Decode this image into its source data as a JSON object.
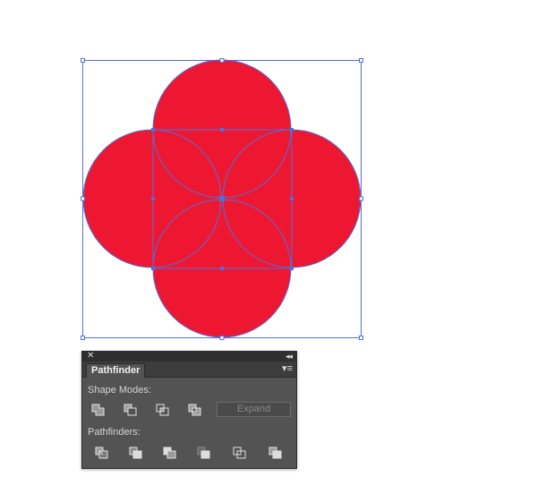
{
  "panel": {
    "close_glyph": "✕",
    "collapse_glyph": "◂◂",
    "tab_title": "Pathfinder",
    "menu_glyph": "▾≡",
    "shape_modes_label": "Shape Modes:",
    "pathfinders_label": "Pathfinders:",
    "expand_label": "Expand",
    "shape_mode_icons": [
      "unite-icon",
      "minus-front-icon",
      "intersect-icon",
      "exclude-icon"
    ],
    "pathfinder_icons": [
      "divide-icon",
      "trim-icon",
      "merge-icon",
      "crop-icon",
      "outline-icon",
      "minus-back-icon"
    ]
  },
  "colors": {
    "shape_fill": "#ee1731",
    "selection": "#4f70dc",
    "panel_bg": "#535353"
  }
}
